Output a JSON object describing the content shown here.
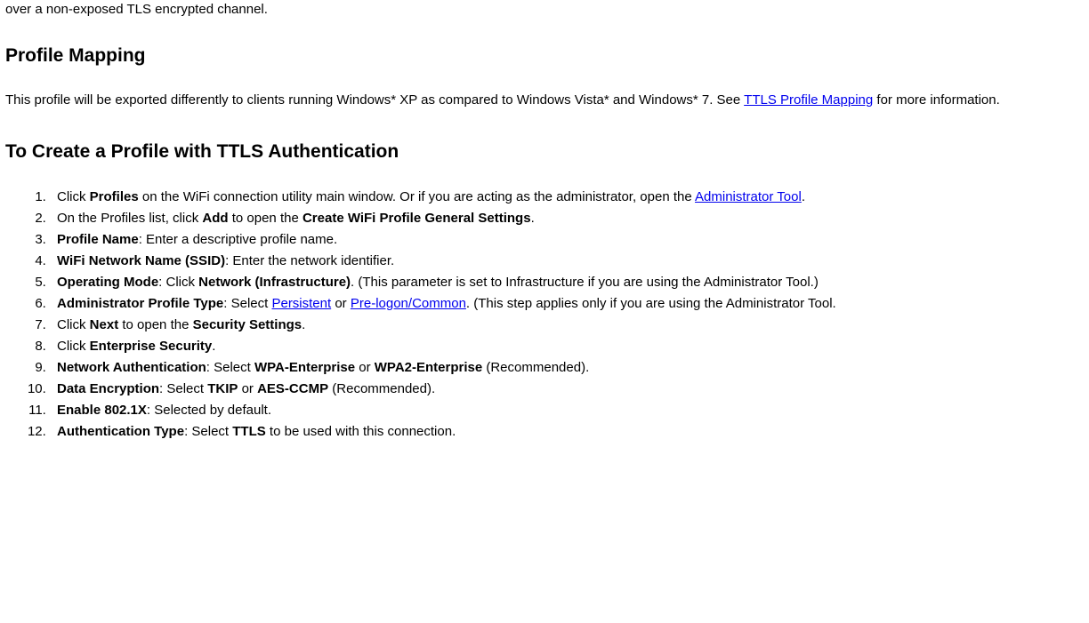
{
  "intro_fragment": "over a non-exposed TLS encrypted channel.",
  "h_profile_mapping": "Profile Mapping",
  "pm_text_before_link": "This profile will be exported differently to clients running Windows* XP as compared to Windows Vista* and Windows* 7. See ",
  "pm_link": "TTLS Profile Mapping",
  "pm_text_after_link": " for more information.",
  "h_create": "To Create a Profile with TTLS Authentication",
  "steps": {
    "s1_a": "Click ",
    "s1_b": "Profiles",
    "s1_c": " on the WiFi connection utility main window. Or if you are acting as the administrator, open the ",
    "s1_link": "Administrator Tool",
    "s1_d": ".",
    "s2_a": "On the Profiles list, click ",
    "s2_b": "Add",
    "s2_c": " to open the ",
    "s2_d": "Create WiFi Profile General Settings",
    "s2_e": ".",
    "s3_a": "Profile Name",
    "s3_b": ": Enter a descriptive profile name.",
    "s4_a": "WiFi Network Name (SSID)",
    "s4_b": ": Enter the network identifier.",
    "s5_a": "Operating Mode",
    "s5_b": ": Click ",
    "s5_c": "Network (Infrastructure)",
    "s5_d": ". (This parameter is set to Infrastructure if you are using the Administrator Tool.)",
    "s6_a": "Administrator Profile Type",
    "s6_b": ": Select ",
    "s6_link1": "Persistent",
    "s6_c": " or ",
    "s6_link2": "Pre-logon/Common",
    "s6_d": ". (This step applies only if you are using the Administrator Tool.",
    "s7_a": "Click ",
    "s7_b": "Next",
    "s7_c": " to open the ",
    "s7_d": "Security Settings",
    "s7_e": ".",
    "s8_a": "Click ",
    "s8_b": "Enterprise Security",
    "s8_c": ".",
    "s9_a": "Network Authentication",
    "s9_b": ": Select ",
    "s9_c": "WPA-Enterprise",
    "s9_d": " or ",
    "s9_e": "WPA2-Enterprise",
    "s9_f": " (Recommended).",
    "s10_a": "Data Encryption",
    "s10_b": ": Select ",
    "s10_c": "TKIP",
    "s10_d": " or ",
    "s10_e": "AES-CCMP",
    "s10_f": " (Recommended).",
    "s11_a": "Enable 802.1X",
    "s11_b": ": Selected by default.",
    "s12_a": "Authentication Type",
    "s12_b": ": Select ",
    "s12_c": "TTLS",
    "s12_d": " to be used with this connection."
  }
}
